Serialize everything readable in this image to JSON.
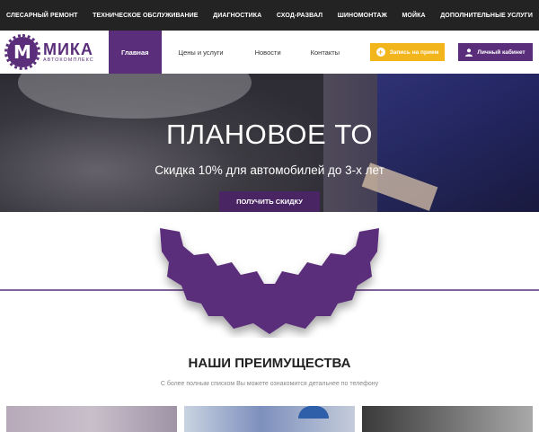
{
  "topbar": {
    "items": [
      "СЛЕСАРНЫЙ РЕМОНТ",
      "ТЕХНИЧЕСКОЕ ОБСЛУЖИВАНИЕ",
      "ДИАГНОСТИКА",
      "СХОД-РАЗВАЛ",
      "ШИНОМОНТАЖ",
      "МОЙКА",
      "ДОПОЛНИТЕЛЬНЫЕ УСЛУГИ"
    ]
  },
  "logo": {
    "mark": "М",
    "name": "МИКА",
    "subtitle": "АВТОКОМПЛЕКС"
  },
  "nav": {
    "items": [
      "Главная",
      "Цены и услуги",
      "Новости",
      "Контакты"
    ]
  },
  "buttons": {
    "appointment": "Запись на прием",
    "cabinet": "Личный кабинет"
  },
  "hero": {
    "title": "ПЛАНОВОЕ ТО",
    "subtitle": "Скидка 10% для автомобилей до 3-х лет",
    "cta": "ПОЛУЧИТЬ СКИДКУ"
  },
  "advantages": {
    "title": "НАШИ ПРЕИМУЩЕСТВА",
    "subtitle": "С более полным списком Вы можете ознакомится детальнее по телефону"
  },
  "colors": {
    "brand": "#5a2e7a",
    "accent": "#f2b51c",
    "topbar": "#232323"
  }
}
